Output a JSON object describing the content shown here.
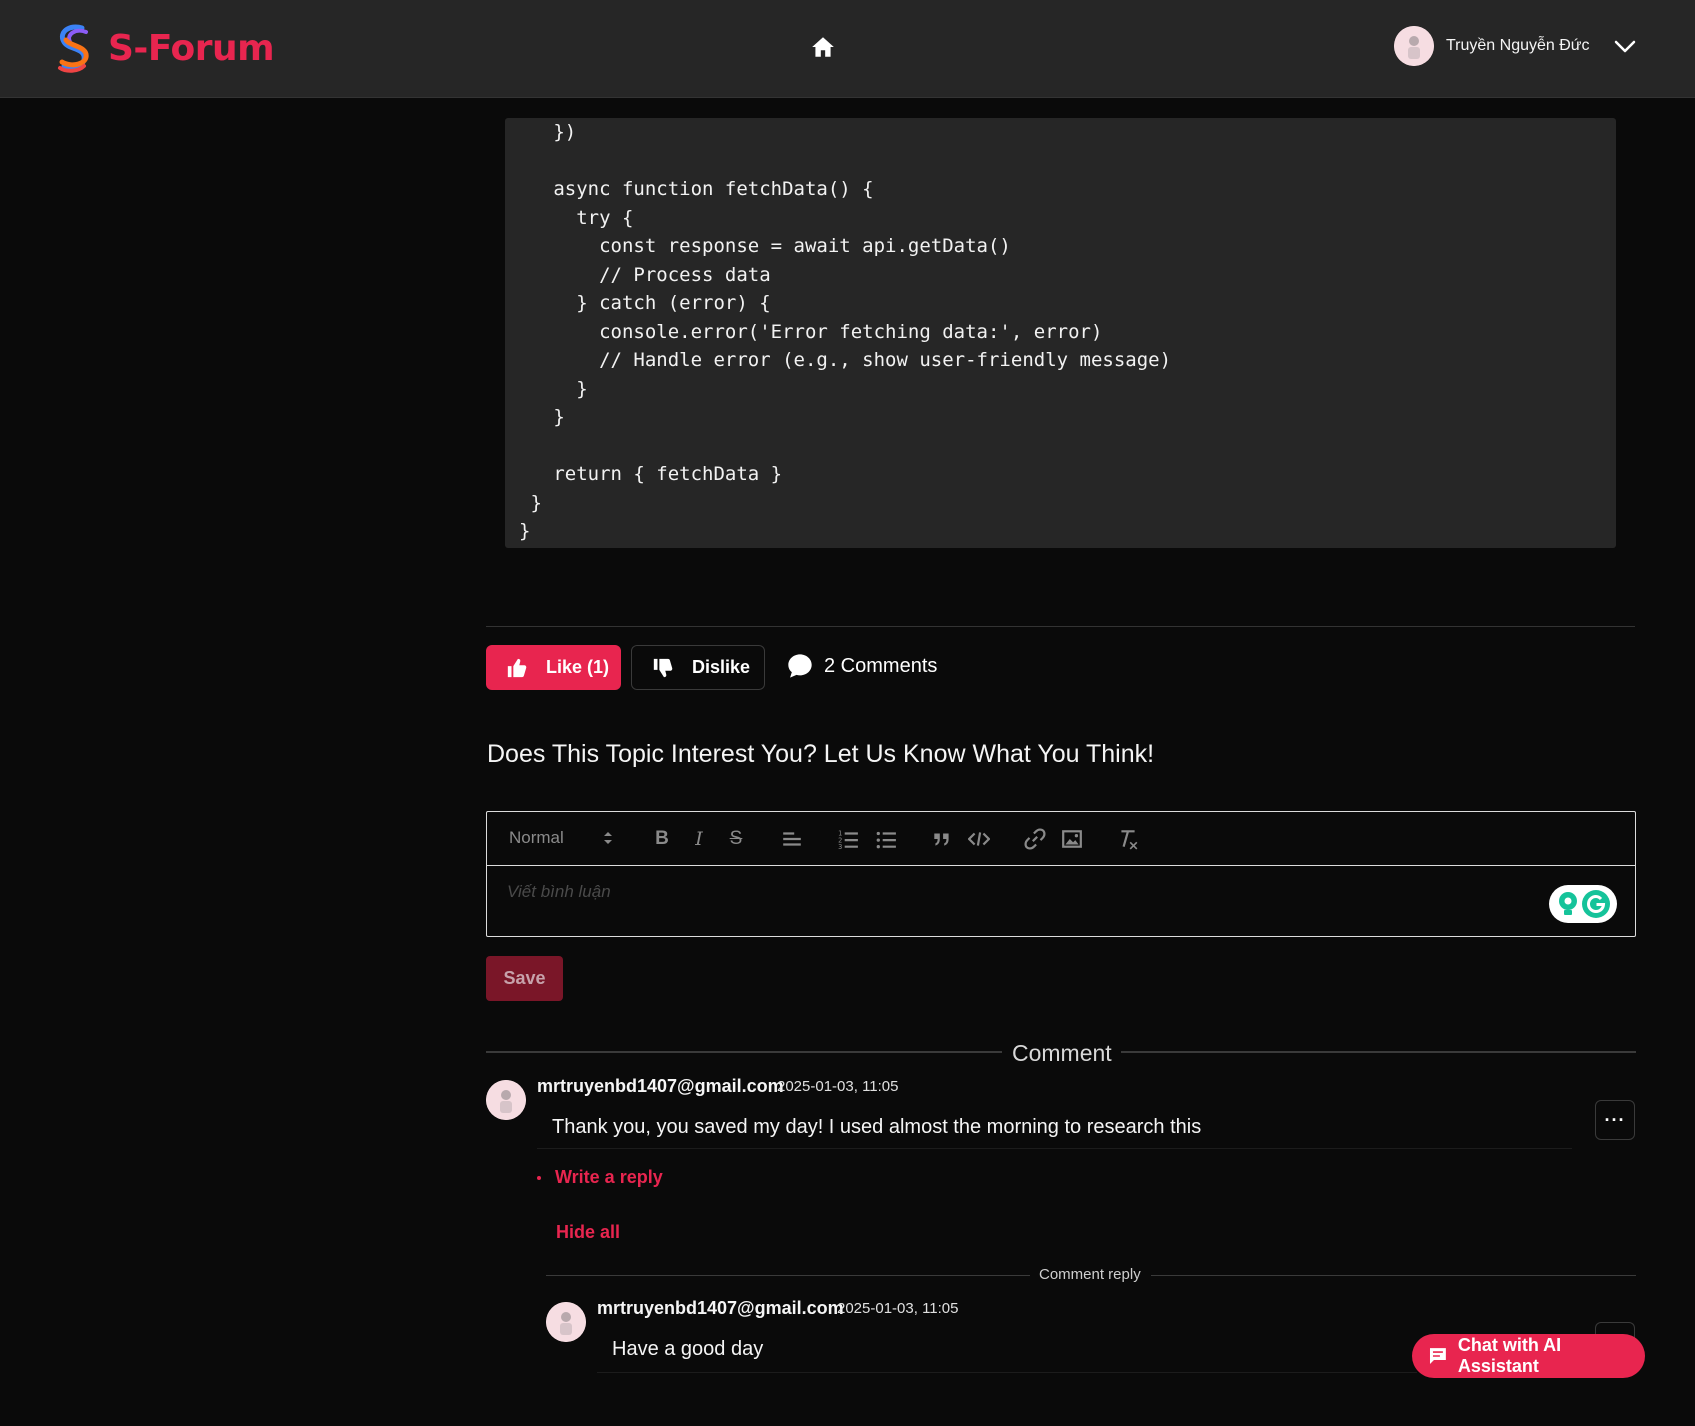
{
  "header": {
    "brand": "S-Forum",
    "user_name": "Truyền Nguyễn Đức"
  },
  "code_block": {
    "code": "   })\n\n   async function fetchData() {\n     try {\n       const response = await api.getData()\n       // Process data\n     } catch (error) {\n       console.error('Error fetching data:', error)\n       // Handle error (e.g., show user-friendly message)\n     }\n   }\n\n   return { fetchData }\n }\n}"
  },
  "actions": {
    "like_label": "Like (1)",
    "dislike_label": "Dislike",
    "comments_label": "2 Comments"
  },
  "prompt": "Does This Topic Interest You? Let Us Know What You Think!",
  "editor": {
    "format_select": "Normal",
    "placeholder": "Viết bình luận",
    "save_label": "Save"
  },
  "comments_section": {
    "title": "Comment",
    "reply_section_title": "Comment reply",
    "write_reply": "Write a reply",
    "hide_all": "Hide all",
    "more": "···",
    "comments": [
      {
        "author": "mrtruyenbd1407@gmail.com",
        "time": "2025-01-03, 11:05",
        "text": "Thank you, you saved my day! I used almost the morning to research this"
      }
    ],
    "replies": [
      {
        "author": "mrtruyenbd1407@gmail.com",
        "time": "2025-01-03, 11:05",
        "text": "Have a good day"
      }
    ]
  },
  "ai_chat": {
    "label": "Chat with AI Assistant"
  },
  "colors": {
    "accent": "#e8254f",
    "header_bg": "#262626",
    "page_bg": "#0a0a0a",
    "code_bg": "#262626"
  }
}
